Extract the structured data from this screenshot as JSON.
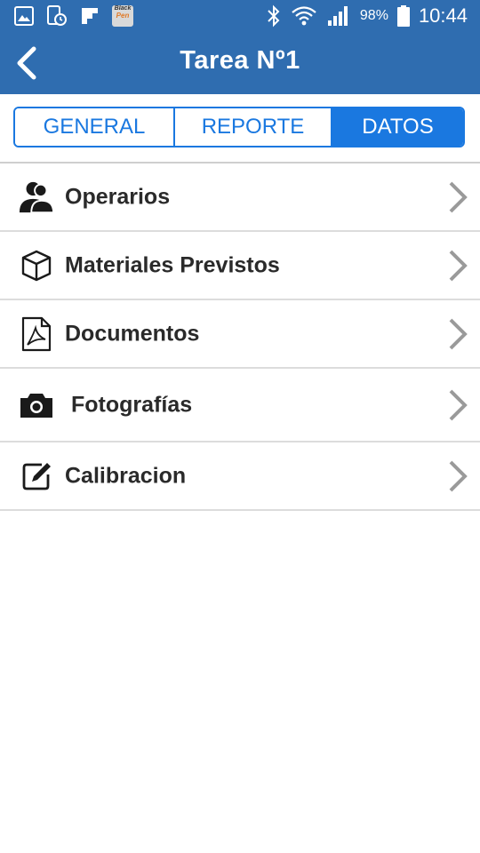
{
  "status_bar": {
    "battery_percent": "98%",
    "time": "10:44",
    "blackpen_line1": "Black",
    "blackpen_line2": "Pen",
    "icons": [
      "gallery-icon",
      "alarm-icon",
      "flipboard-icon",
      "blackpen-app-icon",
      "bluetooth-icon",
      "wifi-icon",
      "signal-icon",
      "battery-icon"
    ]
  },
  "app_bar": {
    "title": "Tarea Nº1",
    "back_icon": "chevron-left-icon"
  },
  "tabs": [
    {
      "label": "GENERAL",
      "active": false
    },
    {
      "label": "REPORTE",
      "active": false
    },
    {
      "label": "DATOS",
      "active": true
    }
  ],
  "menu": [
    {
      "label": "Operarios",
      "icon": "users-icon"
    },
    {
      "label": "Materiales Previstos",
      "icon": "box-icon"
    },
    {
      "label": "Documentos",
      "icon": "pdf-document-icon"
    },
    {
      "label": "Fotografías",
      "icon": "camera-icon"
    },
    {
      "label": "Calibracion",
      "icon": "edit-icon"
    }
  ],
  "colors": {
    "header": "#2f6db0",
    "accent": "#1a78e0",
    "text": "#2a2a2a",
    "chevron": "#9a9a9a"
  }
}
